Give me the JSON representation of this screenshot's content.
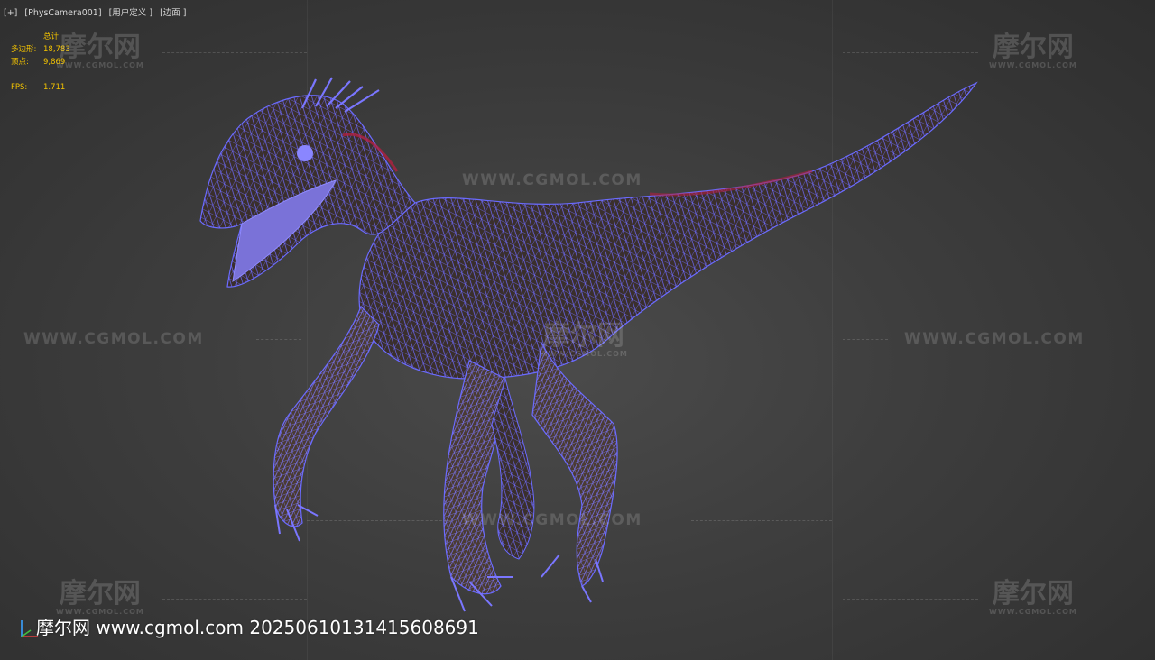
{
  "viewport": {
    "labels": [
      "[+]",
      "[PhysCamera001]",
      "[用户定义 ]",
      "[边面 ]"
    ]
  },
  "stats": {
    "header": "总计",
    "rows": [
      {
        "label": "多边形:",
        "value": "18,783"
      },
      {
        "label": "顶点:",
        "value": "9,869"
      }
    ],
    "fps_label": "FPS:",
    "fps_value": "1.711"
  },
  "watermarks": {
    "logo_text": "摩尔网",
    "logo_sub": "WWW.CGMOL.COM",
    "url_text": "WWW.CGMOL.COM",
    "footer": "摩尔网 www.cgmol.com 20250610131415608691"
  },
  "colors": {
    "stats_text": "#f2c200",
    "wireframe": "#6b6bff",
    "background": "#3d3d3d"
  },
  "icons": {
    "axis": "xyz-axis-gizmo-icon"
  }
}
